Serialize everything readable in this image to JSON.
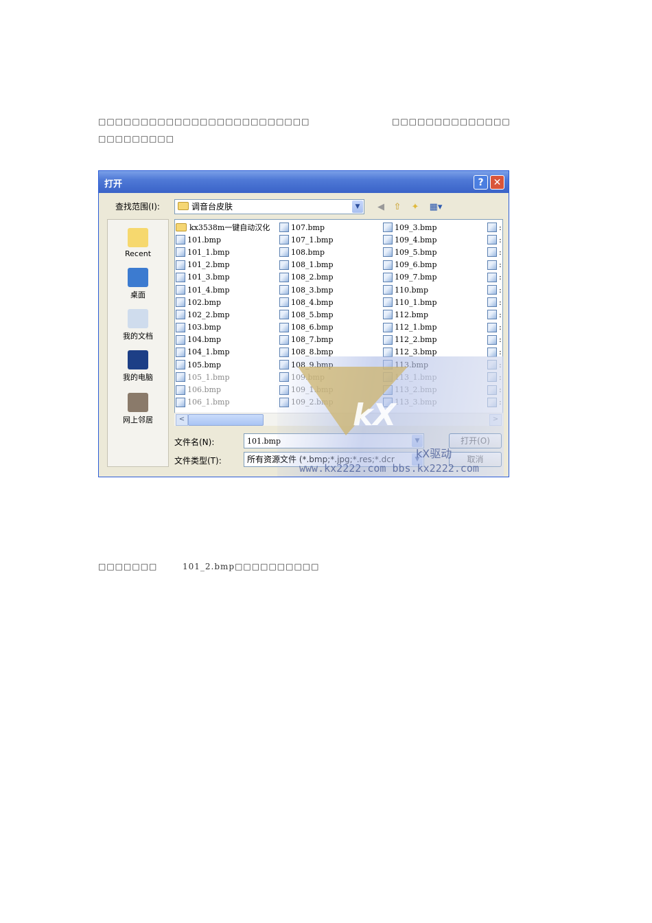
{
  "document": {
    "para1_a": "□□□□□□□□□□□□□□□□□□□□□□□□□",
    "para1_b": "□□□□□□□□□□□□□□",
    "para1_c": "□□□□□□□□□",
    "para2_a": "□□□□□□□",
    "para2_b": "101_2.bmp□□□□□□□□□□"
  },
  "dialog": {
    "title": "打开",
    "help": "?",
    "close": "✕",
    "look_in_label": "查找范围(I):",
    "look_in_value": "调音台皮肤",
    "places": [
      "Recent",
      "桌面",
      "我的文档",
      "我的电脑",
      "网上邻居"
    ],
    "columns": [
      [
        "kx3538m一键自动汉化",
        "101.bmp",
        "101_1.bmp",
        "101_2.bmp",
        "101_3.bmp",
        "101_4.bmp",
        "102.bmp",
        "102_2.bmp",
        "103.bmp",
        "104.bmp",
        "104_1.bmp",
        "105.bmp",
        "105_1.bmp",
        "106.bmp",
        "106_1.bmp"
      ],
      [
        "107.bmp",
        "107_1.bmp",
        "108.bmp",
        "108_1.bmp",
        "108_2.bmp",
        "108_3.bmp",
        "108_4.bmp",
        "108_5.bmp",
        "108_6.bmp",
        "108_7.bmp",
        "108_8.bmp",
        "108_9.bmp",
        "109.bmp",
        "109_1.bmp",
        "109_2.bmp"
      ],
      [
        "109_3.bmp",
        "109_4.bmp",
        "109_5.bmp",
        "109_6.bmp",
        "109_7.bmp",
        "110.bmp",
        "110_1.bmp",
        "112.bmp",
        "112_1.bmp",
        "112_2.bmp",
        "112_3.bmp",
        "113.bmp",
        "113_1.bmp",
        "113_2.bmp",
        "113_3.bmp"
      ],
      [
        ":",
        ":",
        ":",
        ":",
        ":",
        ":",
        ":",
        ":",
        ":",
        ":",
        ":",
        ":",
        ":",
        ":",
        ":"
      ]
    ],
    "filename_label": "文件名(N):",
    "filename_value": "101.bmp",
    "filetype_label": "文件类型(T):",
    "filetype_value": "所有资源文件 (*.bmp;*.jpg;*.res;*.dcr",
    "open_button": "打开(O)",
    "cancel_button": "取消"
  },
  "watermark": {
    "logo": "kX",
    "brand": "kX驱动",
    "url": "www.kx2222.com bbs.kx2222.com"
  }
}
